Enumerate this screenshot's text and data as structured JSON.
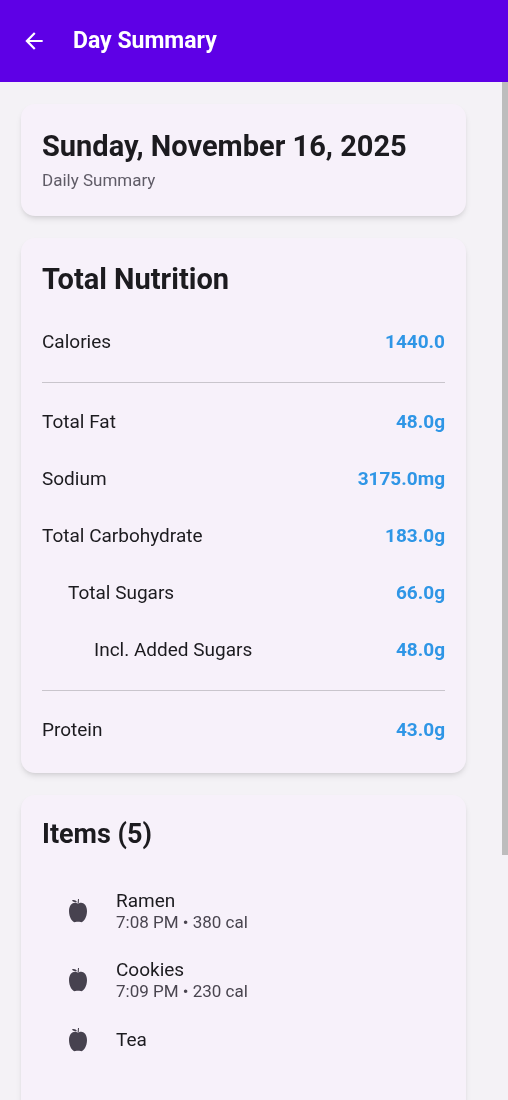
{
  "app_bar": {
    "title": "Day Summary"
  },
  "date_card": {
    "date": "Sunday, November 16, 2025",
    "subtitle": "Daily Summary"
  },
  "nutrition": {
    "title": "Total Nutrition",
    "groups": [
      {
        "rows": [
          {
            "label": "Calories",
            "value": "1440.0"
          }
        ]
      },
      {
        "rows": [
          {
            "label": "Total Fat",
            "value": "48.0g"
          },
          {
            "label": "Sodium",
            "value": "3175.0mg"
          },
          {
            "label": "Total Carbohydrate",
            "value": "183.0g",
            "children": [
              {
                "label": "Total Sugars",
                "value": "66.0g",
                "children": [
                  {
                    "label": "Incl. Added Sugars",
                    "value": "48.0g"
                  }
                ]
              }
            ]
          }
        ]
      },
      {
        "rows": [
          {
            "label": "Protein",
            "value": "43.0g"
          }
        ]
      }
    ]
  },
  "items": {
    "title": "Items (5)",
    "list": [
      {
        "name": "Ramen",
        "detail": "7:08 PM • 380 cal"
      },
      {
        "name": "Cookies",
        "detail": "7:09 PM • 230 cal"
      },
      {
        "name": "Tea"
      }
    ]
  }
}
